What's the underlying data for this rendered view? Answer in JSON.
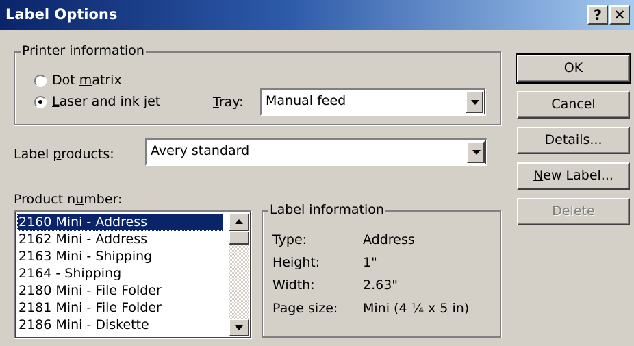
{
  "window": {
    "title": "Label Options",
    "help_button": "?",
    "close_button": "✕"
  },
  "printer_info": {
    "legend": "Printer information",
    "dot_matrix": {
      "pre": "Dot ",
      "accel": "m",
      "post": "atrix",
      "selected": false
    },
    "laser": {
      "pre": "",
      "accel": "L",
      "post": "aser and ink jet",
      "selected": true
    },
    "tray": {
      "pre": "",
      "accel": "T",
      "post": "ray:",
      "value": "Manual feed"
    }
  },
  "label_products": {
    "pre": "Label ",
    "accel": "p",
    "post": "roducts:",
    "value": "Avery standard"
  },
  "product_number": {
    "pre": "Product n",
    "accel": "u",
    "post": "mber:",
    "items": [
      "2160 Mini - Address",
      "2162 Mini - Address",
      "2163 Mini - Shipping",
      "2164 - Shipping",
      "2180 Mini - File Folder",
      "2181 Mini - File Folder",
      "2186 Mini - Diskette"
    ],
    "selected_index": 0
  },
  "label_information": {
    "legend": "Label information",
    "rows": [
      {
        "label": "Type:",
        "value": "Address"
      },
      {
        "label": "Height:",
        "value": "1\""
      },
      {
        "label": "Width:",
        "value": "2.63\""
      },
      {
        "label": "Page size:",
        "value": "Mini (4 ¼ x 5 in)"
      }
    ]
  },
  "buttons": {
    "ok": "OK",
    "cancel": "Cancel",
    "details": {
      "pre": "",
      "accel": "D",
      "post": "etails..."
    },
    "new_label": {
      "pre": "",
      "accel": "N",
      "post": "ew Label..."
    },
    "delete": "Delete"
  }
}
